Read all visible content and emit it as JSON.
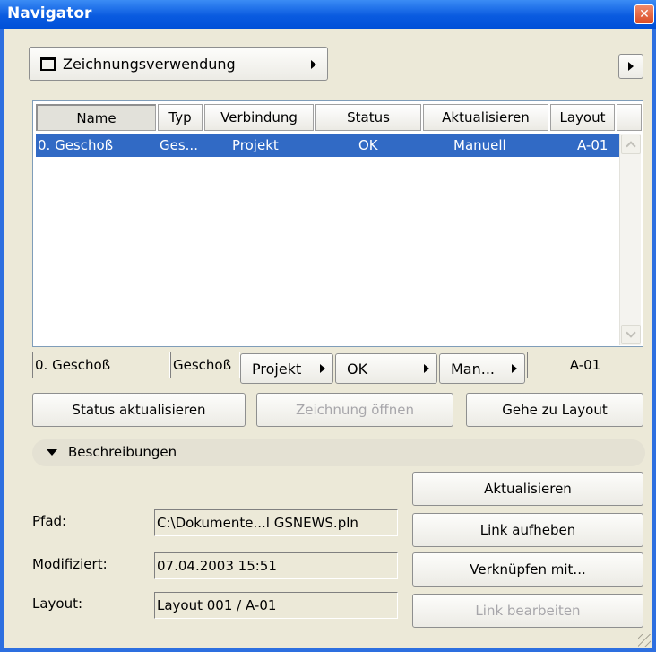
{
  "window": {
    "title": "Navigator"
  },
  "toolbar": {
    "view_label": "Zeichnungsverwendung"
  },
  "table": {
    "columns": [
      "Name",
      "Typ",
      "Verbindung",
      "Status",
      "Aktualisieren",
      "Layout"
    ],
    "rows": [
      {
        "name": "0. Geschoß",
        "typ": "Ges...",
        "verbindung": "Projekt",
        "status": "OK",
        "aktualisieren": "Manuell",
        "layout": "A-01"
      }
    ]
  },
  "detail_row": {
    "name": "0. Geschoß",
    "typ": "Geschoß",
    "verbindung": "Projekt",
    "status": "OK",
    "aktualisieren": "Man...",
    "layout": "A-01"
  },
  "actions": {
    "status_update": "Status aktualisieren",
    "open_drawing": "Zeichnung öffnen",
    "goto_layout": "Gehe zu Layout"
  },
  "descriptions": {
    "header": "Beschreibungen",
    "path_label": "Pfad:",
    "path_value": "C:\\Dokumente...l GSNEWS.pln",
    "modified_label": "Modifiziert:",
    "modified_value": "07.04.2003 15:51",
    "layout_label": "Layout:",
    "layout_value": "Layout 001 / A-01"
  },
  "side_buttons": {
    "update": "Aktualisieren",
    "unlink": "Link aufheben",
    "link_with": "Verknüpfen mit...",
    "edit_link": "Link bearbeiten"
  },
  "icons": [
    "close-icon",
    "window-icon",
    "arrow-right-icon",
    "arrow-down-icon",
    "scroll-up-icon",
    "scroll-down-icon",
    "resize-grip-icon"
  ],
  "colors": {
    "titlebar": "#0a5be0",
    "selection": "#316ac5",
    "window_bg": "#ece9d8"
  }
}
